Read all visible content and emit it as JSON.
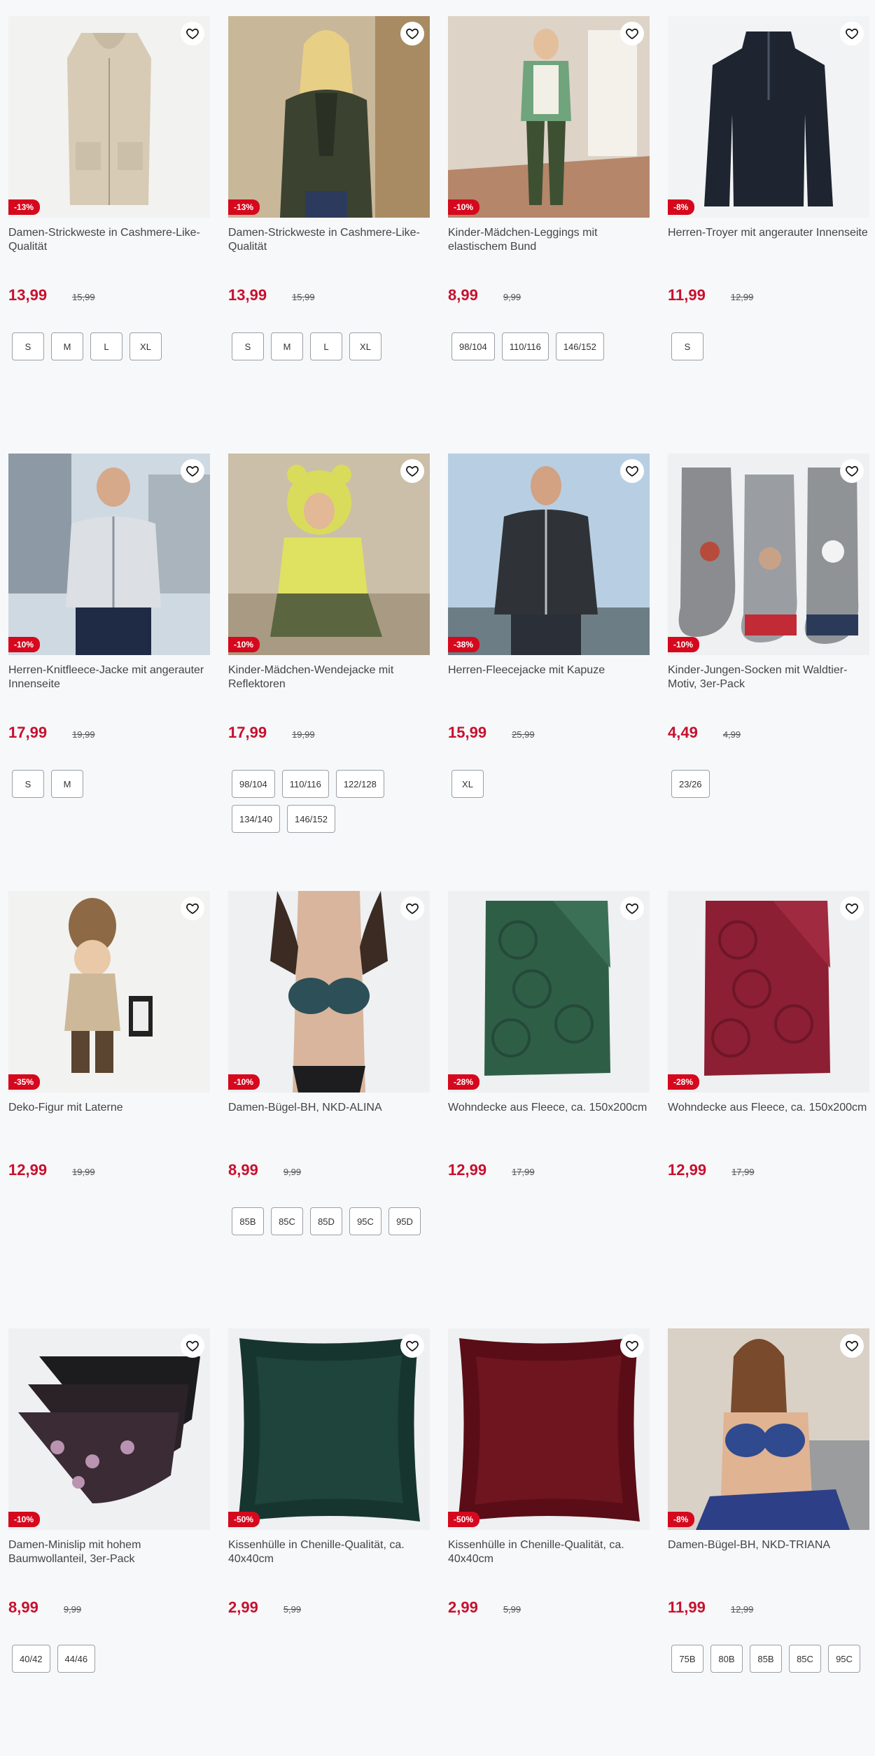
{
  "colors": {
    "accent": "#c8102e",
    "badge": "#d6081d",
    "background": "#f7f8f9"
  },
  "products": [
    {
      "title": "Damen-Strickweste in Cashmere-Like-Qualität",
      "price": "13,99",
      "old_price": "15,99",
      "discount": "-13%",
      "sizes": [
        "S",
        "M",
        "L",
        "XL"
      ],
      "image": "beige-vest"
    },
    {
      "title": "Damen-Strickweste in Cashmere-Like-Qualität",
      "price": "13,99",
      "old_price": "15,99",
      "discount": "-13%",
      "sizes": [
        "S",
        "M",
        "L",
        "XL"
      ],
      "image": "woman-green-cardigan"
    },
    {
      "title": "Kinder-Mädchen-Leggings mit elastischem Bund",
      "price": "8,99",
      "old_price": "9,99",
      "discount": "-10%",
      "sizes": [
        "98/104",
        "110/116",
        "146/152"
      ],
      "image": "girl-leggings"
    },
    {
      "title": "Herren-Troyer mit angerauter Innenseite",
      "price": "11,99",
      "old_price": "12,99",
      "discount": "-8%",
      "sizes": [
        "S"
      ],
      "image": "navy-troyer"
    },
    {
      "title": "Herren-Knitfleece-Jacke mit angerauter Innenseite",
      "price": "17,99",
      "old_price": "19,99",
      "discount": "-10%",
      "sizes": [
        "S",
        "M"
      ],
      "image": "man-fleece-jacket"
    },
    {
      "title": "Kinder-Mädchen-Wendejacke mit Reflektoren",
      "price": "17,99",
      "old_price": "19,99",
      "discount": "-10%",
      "sizes": [
        "98/104",
        "110/116",
        "122/128",
        "134/140",
        "146/152"
      ],
      "image": "girl-yellow-jacket"
    },
    {
      "title": "Herren-Fleecejacke mit Kapuze",
      "price": "15,99",
      "old_price": "25,99",
      "discount": "-38%",
      "sizes": [
        "XL"
      ],
      "image": "man-hooded-fleece"
    },
    {
      "title": "Kinder-Jungen-Socken mit Waldtier-Motiv, 3er-Pack",
      "price": "4,49",
      "old_price": "4,99",
      "discount": "-10%",
      "sizes": [
        "23/26"
      ],
      "image": "animal-socks"
    },
    {
      "title": "Deko-Figur mit Laterne",
      "price": "12,99",
      "old_price": "19,99",
      "discount": "-35%",
      "sizes": [],
      "image": "deco-figure"
    },
    {
      "title": "Damen-Bügel-BH, NKD-ALINA",
      "price": "8,99",
      "old_price": "9,99",
      "discount": "-10%",
      "sizes": [
        "85B",
        "85C",
        "85D",
        "95C",
        "95D"
      ],
      "image": "bra-alina"
    },
    {
      "title": "Wohndecke aus Fleece, ca. 150x200cm",
      "price": "12,99",
      "old_price": "17,99",
      "discount": "-28%",
      "sizes": [],
      "image": "green-blanket"
    },
    {
      "title": "Wohndecke aus Fleece, ca. 150x200cm",
      "price": "12,99",
      "old_price": "17,99",
      "discount": "-28%",
      "sizes": [],
      "image": "red-blanket"
    },
    {
      "title": "Damen-Minislip mit hohem Baumwollanteil, 3er-Pack",
      "price": "8,99",
      "old_price": "9,99",
      "discount": "-10%",
      "sizes": [
        "40/42",
        "44/46"
      ],
      "image": "briefs-pack"
    },
    {
      "title": "Kissenhülle in Chenille-Qualität, ca. 40x40cm",
      "price": "2,99",
      "old_price": "5,99",
      "discount": "-50%",
      "sizes": [],
      "image": "green-cushion"
    },
    {
      "title": "Kissenhülle in Chenille-Qualität, ca. 40x40cm",
      "price": "2,99",
      "old_price": "5,99",
      "discount": "-50%",
      "sizes": [],
      "image": "red-cushion"
    },
    {
      "title": "Damen-Bügel-BH, NKD-TRIANA",
      "price": "11,99",
      "old_price": "12,99",
      "discount": "-8%",
      "sizes": [
        "75B",
        "80B",
        "85B",
        "85C",
        "95C"
      ],
      "image": "bra-triana"
    }
  ]
}
